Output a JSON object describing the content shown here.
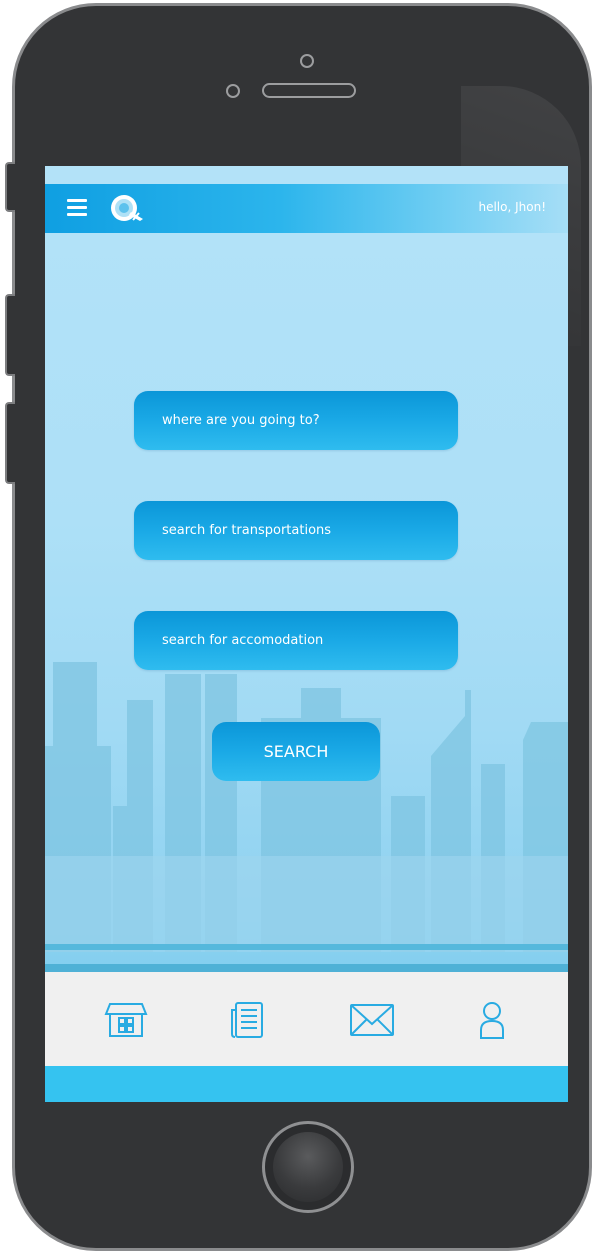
{
  "header": {
    "greeting": "hello, Jhon!",
    "menu_icon": "hamburger-menu-icon",
    "logo_icon": "globe-plane-logo-icon"
  },
  "form": {
    "destination_placeholder": "where are you going to?",
    "transport_placeholder": "search for transportations",
    "accommodation_placeholder": "search for accomodation",
    "search_label": "SEARCH"
  },
  "bottom_nav": {
    "items": [
      {
        "icon": "store-icon"
      },
      {
        "icon": "news-icon"
      },
      {
        "icon": "mail-icon"
      },
      {
        "icon": "user-icon"
      }
    ]
  },
  "colors": {
    "accent": "#1aa9e6",
    "header_start": "#0f9fe2",
    "nav_background": "#f0f0f0",
    "icon_color": "#29abe2",
    "bottom_strip": "#35c3f0"
  }
}
